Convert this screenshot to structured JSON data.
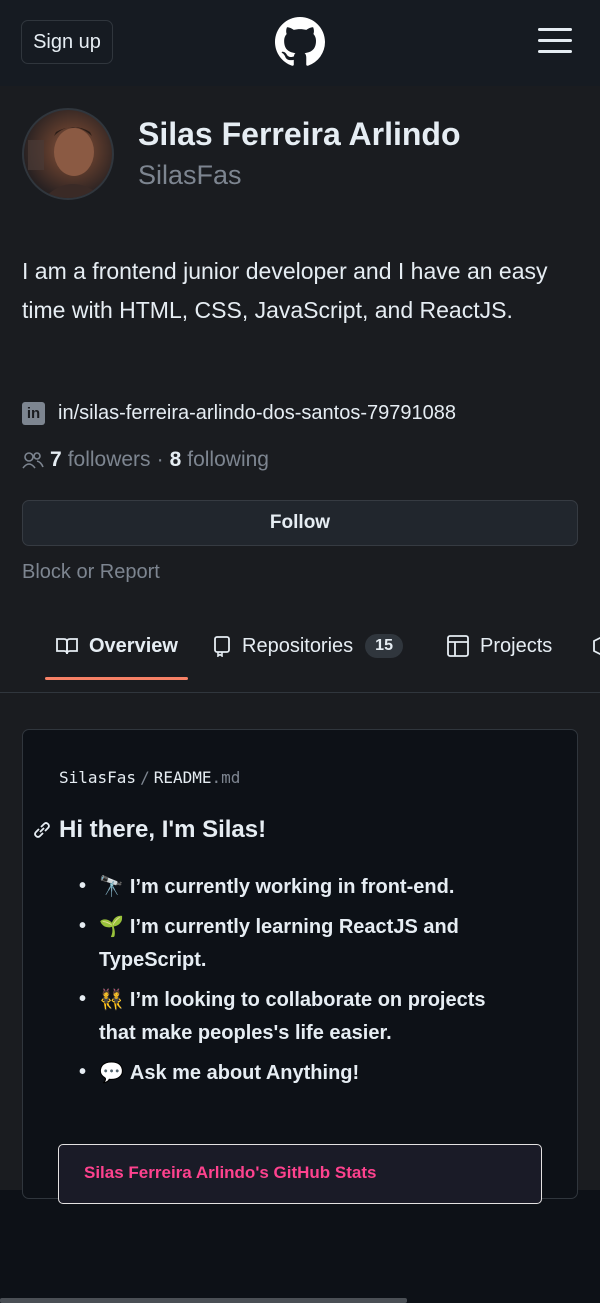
{
  "header": {
    "signup_label": "Sign up",
    "logo_icon": "github-mark-icon",
    "menu_icon": "hamburger-menu-icon"
  },
  "profile": {
    "name": "Silas Ferreira Arlindo",
    "login": "SilasFas",
    "bio": "I am a frontend junior developer and I have an easy time with HTML, CSS, JavaScript, and ReactJS.",
    "linkedin_icon": "linkedin-icon",
    "linkedin": "in/silas-ferreira-arlindo-dos-santos-79791088",
    "followers_count": "7",
    "followers_label": "followers",
    "separator": "·",
    "following_count": "8",
    "following_label": "following",
    "follow_label": "Follow",
    "block_report_label": "Block or Report"
  },
  "tabs": [
    {
      "label": "Overview",
      "icon": "book-icon",
      "selected": true
    },
    {
      "label": "Repositories",
      "icon": "repo-icon",
      "count": "15"
    },
    {
      "label": "Projects",
      "icon": "table-icon"
    }
  ],
  "readme": {
    "owner": "SilasFas",
    "separator": "/",
    "file_base": "README",
    "file_ext": ".md",
    "heading": "Hi there, I'm Silas!",
    "items": [
      {
        "emoji": "🔭",
        "text": "I’m currently working in front-end."
      },
      {
        "emoji": "🌱",
        "text": "I’m currently learning ReactJS and TypeScript."
      },
      {
        "emoji": "👯",
        "text": "I’m looking to collaborate on projects that make peoples's life easier."
      },
      {
        "emoji": "💬",
        "text": "Ask me about Anything!"
      }
    ],
    "stats_title": "Silas Ferreira Arlindo's GitHub Stats"
  },
  "colors": {
    "background": "#0d1117",
    "accent_underline": "#f78166",
    "stats_title": "#fe428e"
  }
}
